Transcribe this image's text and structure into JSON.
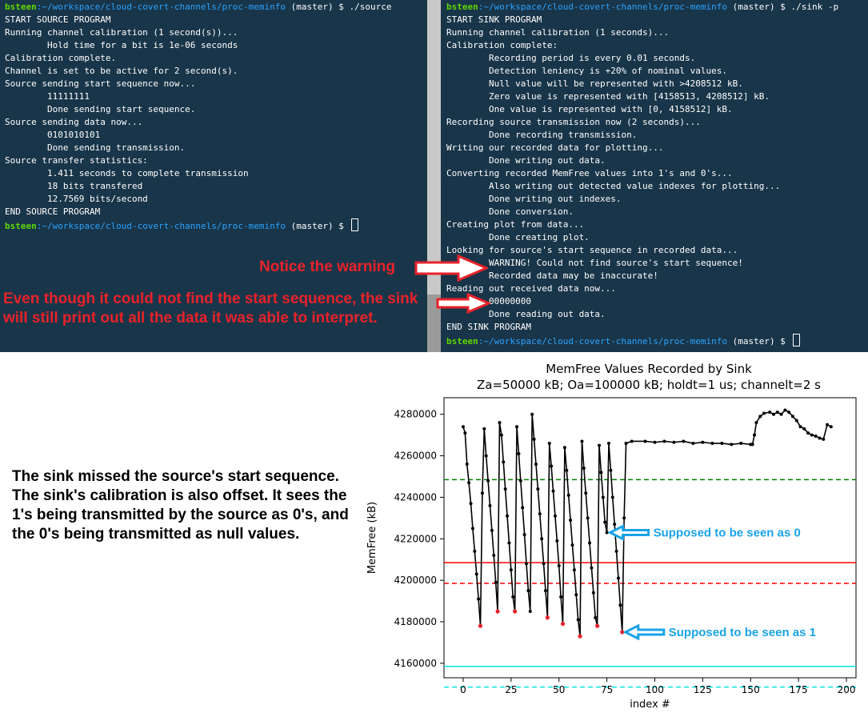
{
  "left_terminal": {
    "prompt_user": "bsteen",
    "prompt_path": ":~/workspace/cloud-covert-channels/proc-meminfo",
    "prompt_branch": " (master) $ ",
    "command": "./source",
    "lines": [
      "START SOURCE PROGRAM",
      "Running channel calibration (1 second(s))...",
      "        Hold time for a bit is 1e-06 seconds",
      "Calibration complete.",
      "Channel is set to be active for 2 second(s).",
      "Source sending start sequence now...",
      "        11111111",
      "        Done sending start sequence.",
      "Source sending data now...",
      "        0101010101",
      "        Done sending transmission.",
      "Source transfer statistics:",
      "        1.411 seconds to complete transmission",
      "        18 bits transfered",
      "        12.7569 bits/second",
      "END SOURCE PROGRAM"
    ]
  },
  "right_terminal": {
    "prompt_user": "bsteen",
    "prompt_path": ":~/workspace/cloud-covert-channels/proc-meminfo",
    "prompt_branch": " (master) $ ",
    "command": "./sink -p",
    "lines": [
      "START SINK PROGRAM",
      "Running channel calibration (1 seconds)...",
      "Calibration complete:",
      "        Recording period is every 0.01 seconds.",
      "        Detection leniency is +20% of nominal values.",
      "        Null value will be represented with >4208512 kB.",
      "        Zero value is represented with [4158513, 4208512] kB.",
      "        One value is represented with [0, 4158512] kB.",
      "Recording source transmission now (2 seconds)...",
      "        Done recording transmission.",
      "Writing our recorded data for plotting...",
      "        Done writing out data.",
      "Converting recorded MemFree values into 1's and 0's...",
      "        Also writing out detected value indexes for plotting...",
      "        Done writing out indexes.",
      "        Done conversion.",
      "Creating plot from data...",
      "        Done creating plot.",
      "Looking for source's start sequence in recorded data...",
      "        WARNING! Could not find source's start sequence!",
      "        Recorded data may be inaccurate!",
      "Reading out received data now...",
      "        00000000",
      "        Done reading out data.",
      "END SINK PROGRAM"
    ]
  },
  "annotations": {
    "warning_note": "Notice the warning",
    "sink_note": "Even though it could not find the start sequence, the sink will still print out all the data it was able to interpret.",
    "summary_line1": "The sink missed the source's start sequence.",
    "summary_line2": "The sink's calibration is also offset. It sees the 1's being transmitted by the source as 0's, and the 0's being transmitted as null values.",
    "arrow_zero": "Supposed to be seen as 0",
    "arrow_one": "Supposed to be seen as 1"
  },
  "colors": {
    "terminal_bg": "#193549",
    "prompt_user": "#5fd700",
    "prompt_path": "#2aa3ff",
    "note_red": "#e8222a",
    "note_blue": "#1aa3e8",
    "series": "#000000",
    "one_points": "#e8222a",
    "null_threshold": "#ff0000",
    "zero_threshold": "#00e5e5",
    "baseline": "#008000"
  },
  "chart_data": {
    "type": "line",
    "title": "MemFree Values Recorded by Sink",
    "subtitle": "Za=50000 kB; Oa=100000 kB; holdt=1 us; channelt=2 s",
    "xlabel": "index #",
    "ylabel": "MemFree (kB)",
    "xlim": [
      -10,
      205
    ],
    "ylim": [
      4153000,
      4288000
    ],
    "xticks": [
      0,
      25,
      50,
      75,
      100,
      125,
      150,
      175,
      200
    ],
    "yticks": [
      4160000,
      4180000,
      4200000,
      4220000,
      4240000,
      4260000,
      4280000
    ],
    "ytick_labels": [
      "4160000",
      "4180000",
      "4200000",
      "4220000",
      "4240000",
      "4260000",
      "4280000"
    ],
    "grid": false,
    "series": [
      {
        "values": [
          [
            0,
            4274000
          ],
          [
            1,
            4271000
          ],
          [
            2,
            4256000
          ],
          [
            3,
            4247000
          ],
          [
            4,
            4237000
          ],
          [
            5,
            4225000
          ],
          [
            6,
            4214000
          ],
          [
            7,
            4203000
          ],
          [
            8,
            4191000
          ],
          [
            9,
            4178000
          ],
          [
            10,
            4242000
          ],
          [
            11,
            4273000
          ],
          [
            12,
            4260000
          ],
          [
            13,
            4248000
          ],
          [
            14,
            4236000
          ],
          [
            15,
            4224000
          ],
          [
            16,
            4212000
          ],
          [
            17,
            4199000
          ],
          [
            18,
            4185000
          ],
          [
            19,
            4276000
          ],
          [
            20,
            4270000
          ],
          [
            21,
            4257000
          ],
          [
            22,
            4244000
          ],
          [
            23,
            4231000
          ],
          [
            24,
            4218000
          ],
          [
            25,
            4205000
          ],
          [
            26,
            4192000
          ],
          [
            27,
            4185000
          ],
          [
            28,
            4274000
          ],
          [
            29,
            4261000
          ],
          [
            30,
            4248000
          ],
          [
            31,
            4235000
          ],
          [
            32,
            4222000
          ],
          [
            33,
            4208000
          ],
          [
            34,
            4195000
          ],
          [
            35,
            4185000
          ],
          [
            36,
            4280000
          ],
          [
            37,
            4268000
          ],
          [
            38,
            4256000
          ],
          [
            39,
            4244000
          ],
          [
            40,
            4232000
          ],
          [
            41,
            4220000
          ],
          [
            42,
            4208000
          ],
          [
            43,
            4195000
          ],
          [
            44,
            4182000
          ],
          [
            45,
            4266000
          ],
          [
            46,
            4255000
          ],
          [
            47,
            4243000
          ],
          [
            48,
            4231000
          ],
          [
            49,
            4219000
          ],
          [
            50,
            4207000
          ],
          [
            51,
            4192000
          ],
          [
            52,
            4179000
          ],
          [
            53,
            4264000
          ],
          [
            54,
            4253000
          ],
          [
            55,
            4241000
          ],
          [
            56,
            4229000
          ],
          [
            57,
            4217000
          ],
          [
            58,
            4205000
          ],
          [
            59,
            4193000
          ],
          [
            60,
            4181000
          ],
          [
            61,
            4173000
          ],
          [
            62,
            4267000
          ],
          [
            63,
            4254000
          ],
          [
            64,
            4242000
          ],
          [
            65,
            4230000
          ],
          [
            66,
            4218000
          ],
          [
            67,
            4206000
          ],
          [
            68,
            4194000
          ],
          [
            69,
            4182000
          ],
          [
            70,
            4178000
          ],
          [
            71,
            4265000
          ],
          [
            72,
            4252000
          ],
          [
            73,
            4240000
          ],
          [
            74,
            4228000
          ],
          [
            75,
            4223000
          ],
          [
            76,
            4266000
          ],
          [
            77,
            4253000
          ],
          [
            78,
            4240000
          ],
          [
            79,
            4227000
          ],
          [
            80,
            4214000
          ],
          [
            81,
            4201000
          ],
          [
            82,
            4188000
          ],
          [
            83,
            4175000
          ],
          [
            84,
            4230000
          ],
          [
            85,
            4266000
          ],
          [
            88,
            4267000
          ],
          [
            95,
            4267000
          ],
          [
            100,
            4266500
          ],
          [
            105,
            4267000
          ],
          [
            110,
            4266500
          ],
          [
            115,
            4267000
          ],
          [
            120,
            4266000
          ],
          [
            125,
            4266500
          ],
          [
            130,
            4266000
          ],
          [
            135,
            4266000
          ],
          [
            140,
            4265500
          ],
          [
            145,
            4266000
          ],
          [
            150,
            4265500
          ],
          [
            151,
            4265500
          ],
          [
            152,
            4270000
          ],
          [
            153,
            4276000
          ],
          [
            155,
            4279000
          ],
          [
            157,
            4280500
          ],
          [
            160,
            4281000
          ],
          [
            162,
            4280000
          ],
          [
            164,
            4281000
          ],
          [
            166,
            4280000
          ],
          [
            168,
            4282000
          ],
          [
            170,
            4281000
          ],
          [
            172,
            4279000
          ],
          [
            174,
            4277000
          ],
          [
            176,
            4274000
          ],
          [
            178,
            4273000
          ],
          [
            180,
            4271000
          ],
          [
            182,
            4270000
          ],
          [
            184,
            4269500
          ],
          [
            186,
            4268500
          ],
          [
            188,
            4268000
          ],
          [
            190,
            4275000
          ],
          [
            192,
            4274000
          ]
        ]
      }
    ],
    "one_points": [
      [
        9,
        4178000
      ],
      [
        18,
        4185000
      ],
      [
        27,
        4185000
      ],
      [
        44,
        4182000
      ],
      [
        52,
        4179000
      ],
      [
        61,
        4173000
      ],
      [
        70,
        4178000
      ],
      [
        83,
        4175000
      ]
    ],
    "reference_lines": [
      {
        "y": 4248512,
        "color": "#008000",
        "style": "dashed"
      },
      {
        "y": 4208512,
        "color": "#ff0000",
        "style": "solid"
      },
      {
        "y": 4198512,
        "color": "#ff0000",
        "style": "dashed"
      },
      {
        "y": 4158512,
        "color": "#00e5e5",
        "style": "solid"
      },
      {
        "y": 4148512,
        "color": "#00e5e5",
        "style": "dashed"
      }
    ],
    "arrow_targets": [
      [
        75,
        4223000
      ],
      [
        83,
        4175000
      ]
    ]
  }
}
